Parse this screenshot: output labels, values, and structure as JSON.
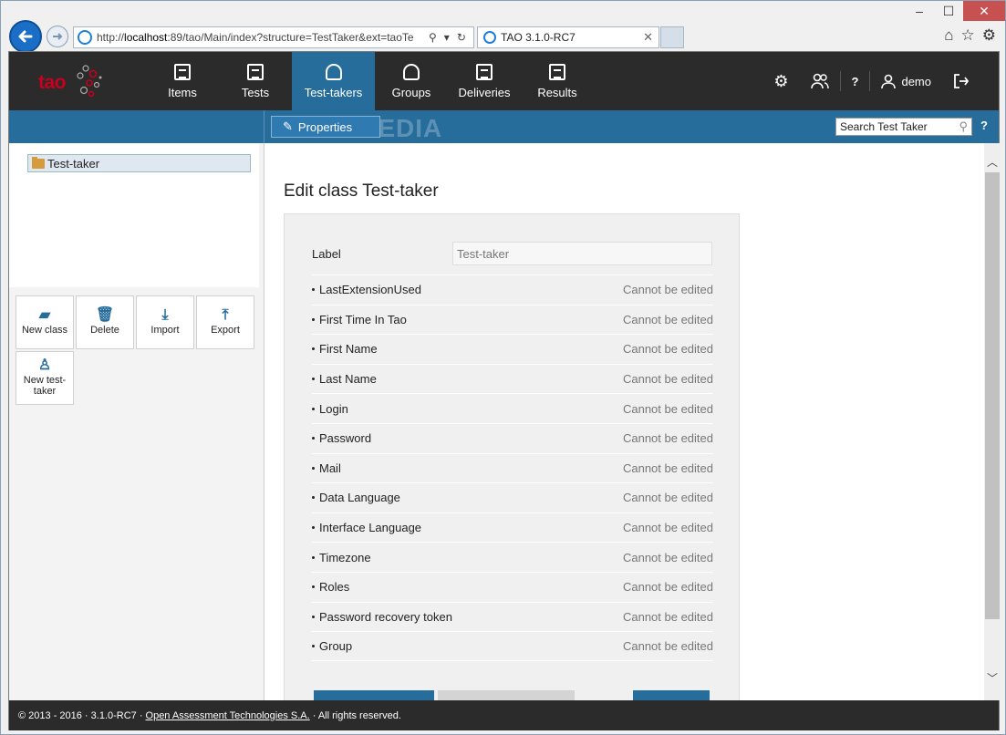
{
  "browser": {
    "url_prefix": "http://",
    "url_host": "localhost",
    "url_rest": ":89/tao/Main/index?structure=TestTaker&ext=taoTe",
    "tab_title": "TAO 3.1.0-RC7"
  },
  "header": {
    "logo": "tao",
    "nav": [
      {
        "label": "Items"
      },
      {
        "label": "Tests"
      },
      {
        "label": "Test-takers"
      },
      {
        "label": "Groups"
      },
      {
        "label": "Deliveries"
      },
      {
        "label": "Results"
      }
    ],
    "active": "Test-takers",
    "help": "?",
    "user": "demo"
  },
  "subbar": {
    "properties_label": "Properties",
    "search_placeholder": "Search Test Taker",
    "help": "?",
    "watermark": "SOFTPEDIA"
  },
  "sidebar": {
    "tree_root": "Test-taker",
    "actions": [
      {
        "label": "New class",
        "icon": "folder-open-icon"
      },
      {
        "label": "Delete",
        "icon": "trash-icon"
      },
      {
        "label": "Import",
        "icon": "import-icon"
      },
      {
        "label": "Export",
        "icon": "export-icon"
      },
      {
        "label": "New test-taker",
        "icon": "test-taker-icon"
      }
    ]
  },
  "main": {
    "title": "Edit class Test-taker",
    "label_field": {
      "label": "Label",
      "value": "Test-taker"
    },
    "properties": [
      {
        "name": "LastExtensionUsed",
        "status": "Cannot be edited"
      },
      {
        "name": "First Time In Tao",
        "status": "Cannot be edited"
      },
      {
        "name": "First Name",
        "status": "Cannot be edited"
      },
      {
        "name": "Last Name",
        "status": "Cannot be edited"
      },
      {
        "name": "Login",
        "status": "Cannot be edited"
      },
      {
        "name": "Password",
        "status": "Cannot be edited"
      },
      {
        "name": "Mail",
        "status": "Cannot be edited"
      },
      {
        "name": "Data Language",
        "status": "Cannot be edited"
      },
      {
        "name": "Interface Language",
        "status": "Cannot be edited"
      },
      {
        "name": "Timezone",
        "status": "Cannot be edited"
      },
      {
        "name": "Roles",
        "status": "Cannot be edited"
      },
      {
        "name": "Password recovery token",
        "status": "Cannot be edited"
      },
      {
        "name": "Group",
        "status": "Cannot be edited"
      }
    ]
  },
  "footer": {
    "prefix": "© 2013 - 2016 · 3.1.0-RC7 ·",
    "company": "Open Assessment Technologies S.A.",
    "suffix": "· All rights reserved."
  },
  "colors": {
    "accent": "#266d9c",
    "header_bg": "#2b2b2b",
    "logo_red": "#c8001e"
  }
}
